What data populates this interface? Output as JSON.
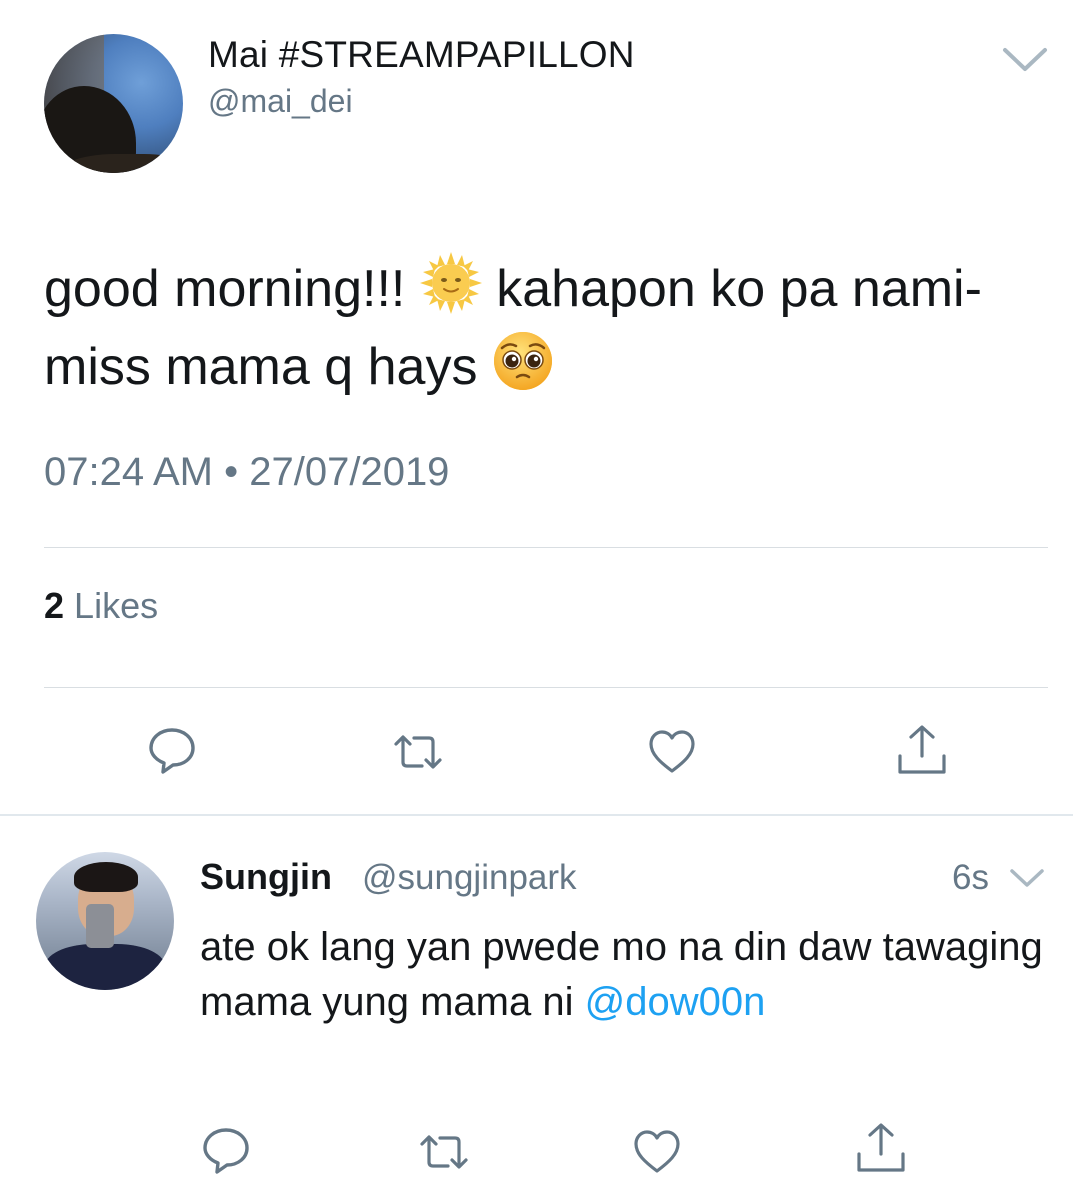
{
  "tweet": {
    "display_name": "Mai #STREAMPAPILLON",
    "handle": "@mai_dei",
    "text_part1": "good morning!!! ",
    "emoji_1": "sun-with-face",
    "text_part2": " kahapon ko pa nami-miss mama q hays ",
    "emoji_2": "pleading-face",
    "timestamp": "07:24 AM • 27/07/2019",
    "likes_count": "2",
    "likes_label": "Likes"
  },
  "reply": {
    "display_name": "Sungjin",
    "handle": "@sungjinpark",
    "time": "6s",
    "text": "ate ok lang yan pwede mo na din daw tawaging mama yung mama ni ",
    "mention": "@dow00n"
  },
  "icons": {
    "reply": "reply-icon",
    "retweet": "retweet-icon",
    "like": "heart-icon",
    "share": "share-icon",
    "menu": "chevron-down-icon"
  },
  "colors": {
    "text": "#14171a",
    "secondary": "#657786",
    "link": "#1da1f2",
    "divider": "#d9dee2"
  }
}
